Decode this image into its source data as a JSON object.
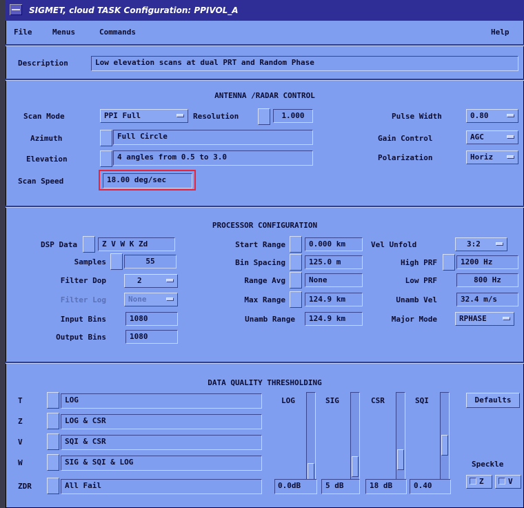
{
  "window": {
    "title": "SIGMET, cloud  TASK Configuration: PPIVOL_A"
  },
  "menu": {
    "file": "File",
    "menus": "Menus",
    "commands": "Commands",
    "help": "Help"
  },
  "description": {
    "label": "Description",
    "value": "Low elevation scans at dual PRT and Random Phase"
  },
  "antenna": {
    "header": "ANTENNA /RADAR CONTROL",
    "scan_mode_label": "Scan Mode",
    "scan_mode_value": "PPI Full",
    "resolution_label": "Resolution",
    "resolution_value": "1.000",
    "azimuth_label": "Azimuth",
    "azimuth_value": "Full Circle",
    "elevation_label": "Elevation",
    "elevation_value": "4 angles from 0.5 to 3.0",
    "scan_speed_label": "Scan Speed",
    "scan_speed_value": "18.00 deg/sec",
    "pulse_width_label": "Pulse Width",
    "pulse_width_value": "0.80",
    "gain_control_label": "Gain Control",
    "gain_control_value": "AGC",
    "polarization_label": "Polarization",
    "polarization_value": "Horiz"
  },
  "processor": {
    "header": "PROCESSOR CONFIGURATION",
    "dsp_data_label": "DSP Data",
    "dsp_data_value": "Z V W K Zd",
    "samples_label": "Samples",
    "samples_value": "55",
    "filter_dop_label": "Filter Dop",
    "filter_dop_value": "2",
    "filter_log_label": "Filter Log",
    "filter_log_value": "None",
    "input_bins_label": "Input Bins",
    "input_bins_value": "1080",
    "output_bins_label": "Output Bins",
    "output_bins_value": "1080",
    "start_range_label": "Start Range",
    "start_range_value": "0.000 km",
    "bin_spacing_label": "Bin Spacing",
    "bin_spacing_value": "125.0 m",
    "range_avg_label": "Range Avg",
    "range_avg_value": "None",
    "max_range_label": "Max Range",
    "max_range_value": "124.9 km",
    "unamb_range_label": "Unamb Range",
    "unamb_range_value": "124.9 km",
    "vel_unfold_label": "Vel Unfold",
    "vel_unfold_value": "3:2",
    "high_prf_label": "High PRF",
    "high_prf_value": "1200 Hz",
    "low_prf_label": "Low PRF",
    "low_prf_value": "800 Hz",
    "unamb_vel_label": "Unamb Vel",
    "unamb_vel_value": "32.4 m/s",
    "major_mode_label": "Major Mode",
    "major_mode_value": "RPHASE"
  },
  "dqt": {
    "header": "DATA QUALITY THRESHOLDING",
    "rows": [
      {
        "label": "T",
        "value": "LOG"
      },
      {
        "label": "Z",
        "value": "LOG & CSR"
      },
      {
        "label": "V",
        "value": "SQI & CSR"
      },
      {
        "label": "W",
        "value": "SIG & SQI & LOG"
      },
      {
        "label": "ZDR",
        "value": "All Fail"
      }
    ],
    "sliders": [
      {
        "label": "LOG",
        "value": "0.0dB",
        "level": 0.0
      },
      {
        "label": "SIG",
        "value": "5 dB",
        "level": 0.1
      },
      {
        "label": "CSR",
        "value": "18 dB",
        "level": 0.2
      },
      {
        "label": "SQI",
        "value": "0.40",
        "level": 0.4
      }
    ],
    "defaults_label": "Defaults",
    "speckle_label": "Speckle",
    "speckle_z": "Z",
    "speckle_v": "V"
  },
  "colors": {
    "panel": "#7f9ef0",
    "title_bar": "#2e2e96",
    "highlight": "#e8243a"
  }
}
